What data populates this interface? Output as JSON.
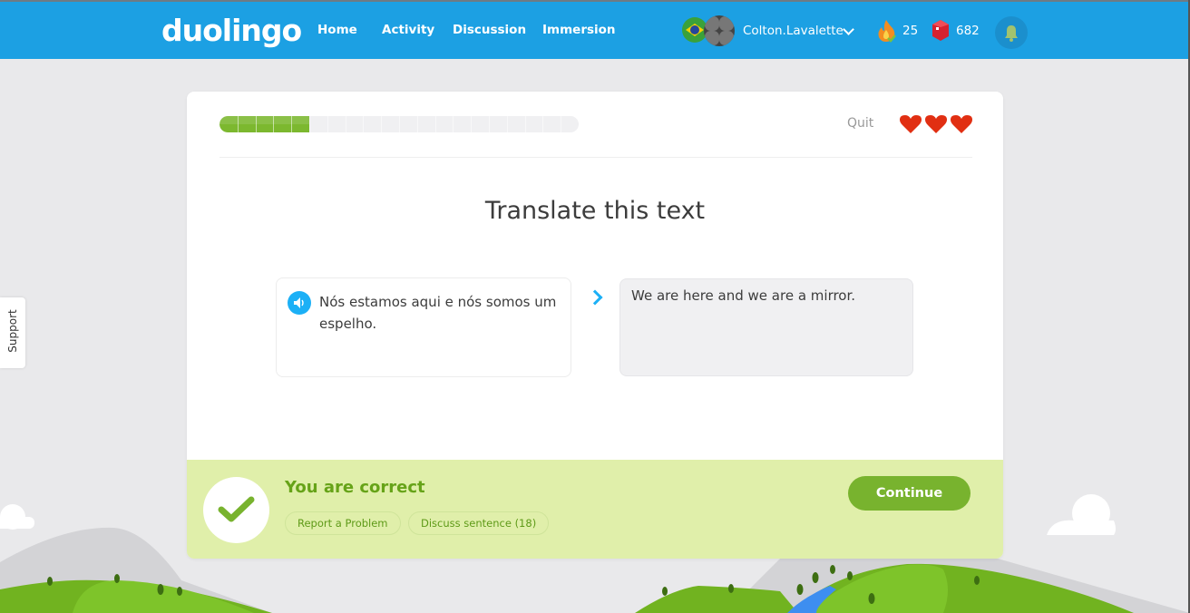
{
  "topbar": {
    "logo": "duolingo",
    "nav": [
      {
        "label": "Home"
      },
      {
        "label": "Activity"
      },
      {
        "label": "Discussion"
      },
      {
        "label": "Immersion"
      }
    ],
    "language_flag": "brazil-flag-icon",
    "username": "Colton.Lavalette",
    "streak": "25",
    "lingots": "682",
    "colors": {
      "bar": "#1ca0e3"
    }
  },
  "support": {
    "label": "Support"
  },
  "lesson": {
    "progress": {
      "completed_segments": 5,
      "total_segments": 20,
      "fraction": 0.25
    },
    "quit_label": "Quit",
    "hearts": 3,
    "title": "Translate this text",
    "source_sentence": "Nós estamos aqui e nós somos um espelho.",
    "answer_value": "We are here and we are a mirror."
  },
  "result": {
    "message": "You are correct",
    "report_label": "Report a Problem",
    "discuss_label": "Discuss sentence (18)",
    "continue_label": "Continue",
    "colors": {
      "background": "#e0efaa",
      "accent": "#78b32e"
    }
  }
}
